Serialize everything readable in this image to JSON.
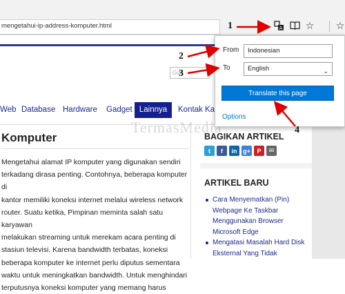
{
  "browser": {
    "address": "mengetahui-ip-address-komputer.html",
    "icons": [
      "translate-icon",
      "reading-view-icon",
      "favorite-star-icon",
      "add-to-favorites-icon"
    ]
  },
  "site": {
    "search_placeholder": "Goo",
    "nav": [
      "Web",
      "Database",
      "Hardware",
      "Gadget",
      "Lainnya",
      "Kontak Kami"
    ],
    "nav_active": "Lainnya",
    "article_title": "Komputer",
    "article_lines": [
      "Mengetahui alamat IP komputer yang digunakan sendiri",
      "terkadang dirasa penting. Contohnya, beberapa komputer di",
      "kantor memiliki koneksi internet melalui wireless network",
      "router. Suatu ketika, Pimpinan meminta salah satu karyawan",
      "melakukan streaming untuk merekam acara penting di",
      "stasiun televisi. Karena bandwidth terbatas, koneksi",
      "beberapa komputer ke internet perlu diputus sementara",
      "waktu untuk meningkatkan bandwidth. Untuk menghindari",
      "terputusnya koneksi komputer yang memang harus"
    ],
    "share_title": "BAGIKAN ARTIKEL",
    "share_buttons": [
      {
        "icon": "twitter-icon",
        "glyph": "t",
        "color": "#2e9fd8"
      },
      {
        "icon": "facebook-icon",
        "glyph": "f",
        "color": "#3b5998"
      },
      {
        "icon": "linkedin-icon",
        "glyph": "in",
        "color": "#0a66a8"
      },
      {
        "icon": "google-plus-icon",
        "glyph": "g+",
        "color": "#3f7fd6"
      },
      {
        "icon": "pinterest-icon",
        "glyph": "P",
        "color": "#cb2027"
      },
      {
        "icon": "email-icon",
        "glyph": "✉",
        "color": "#666666"
      }
    ],
    "recent_title": "ARTIKEL BARU",
    "recent_items": [
      "Cara Menyematkan (Pin) Webpage Ke Taskbar Menggunakan Browser Microsoft Edge",
      "Mengatasi Masalah Hard Disk Eksternal Yang Tidak"
    ],
    "watermark": "TermasMedia"
  },
  "translate_popup": {
    "from_label": "From",
    "from_value": "Indonesian",
    "to_label": "To",
    "to_value": "English",
    "button_label": "Translate this page",
    "options_label": "Options"
  },
  "annotations": [
    "1",
    "2",
    "3",
    "4"
  ],
  "colors": {
    "accent": "#0078d7",
    "arrow": "#e00000",
    "nav_active": "#14208f"
  }
}
